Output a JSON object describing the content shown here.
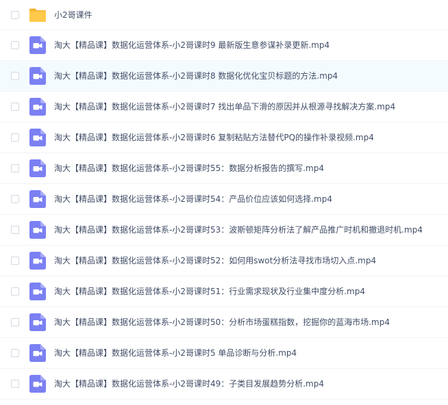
{
  "files": [
    {
      "name": "小2哥课件",
      "type": "folder",
      "icon": "folder-icon"
    },
    {
      "name": "淘大【精品课】数据化运营体系-小2哥课时9 最新版生意参谋补录更新.mp4",
      "type": "video",
      "icon": "video-file-icon"
    },
    {
      "name": "淘大【精品课】数据化运营体系-小2哥课时8 数据化优化宝贝标题的方法.mp4",
      "type": "video",
      "icon": "video-file-icon"
    },
    {
      "name": "淘大【精品课】数据化运营体系-小2哥课时7 找出单品下滑的原因并从根源寻找解决方案.mp4",
      "type": "video",
      "icon": "video-file-icon"
    },
    {
      "name": "淘大【精品课】数据化运营体系-小2哥课时6 复制粘贴方法替代PQ的操作补录视频.mp4",
      "type": "video",
      "icon": "video-file-icon"
    },
    {
      "name": "淘大【精品课】数据化运营体系-小2哥课时55：数据分析报告的撰写.mp4",
      "type": "video",
      "icon": "video-file-icon"
    },
    {
      "name": "淘大【精品课】数据化运营体系-小2哥课时54：产品价位应该如何选择.mp4",
      "type": "video",
      "icon": "video-file-icon"
    },
    {
      "name": "淘大【精品课】数据化运营体系-小2哥课时53：波斯顿矩阵分析法了解产品推广时机和撤退时机.mp4",
      "type": "video",
      "icon": "video-file-icon"
    },
    {
      "name": "淘大【精品课】数据化运营体系-小2哥课时52：如何用swot分析法寻找市场切入点.mp4",
      "type": "video",
      "icon": "video-file-icon"
    },
    {
      "name": "淘大【精品课】数据化运营体系-小2哥课时51：行业需求现状及行业集中度分析.mp4",
      "type": "video",
      "icon": "video-file-icon"
    },
    {
      "name": "淘大【精品课】数据化运营体系-小2哥课时50：分析市场蛋糕指数，挖掘你的蓝海市场.mp4",
      "type": "video",
      "icon": "video-file-icon"
    },
    {
      "name": "淘大【精品课】数据化运营体系-小2哥课时5 单品诊断与分析.mp4",
      "type": "video",
      "icon": "video-file-icon"
    },
    {
      "name": "淘大【精品课】数据化运营体系-小2哥课时49：子类目发展趋势分析.mp4",
      "type": "video",
      "icon": "video-file-icon"
    }
  ],
  "hovered_row": 2,
  "colors": {
    "folder": "#ffc94a",
    "folder_tab": "#f5b631",
    "video_icon": "#7b80f3",
    "text": "#424e67",
    "row_hover": "#f4fbff",
    "divider": "#f1f3f7",
    "checkbox_border": "#d3d9e2"
  }
}
